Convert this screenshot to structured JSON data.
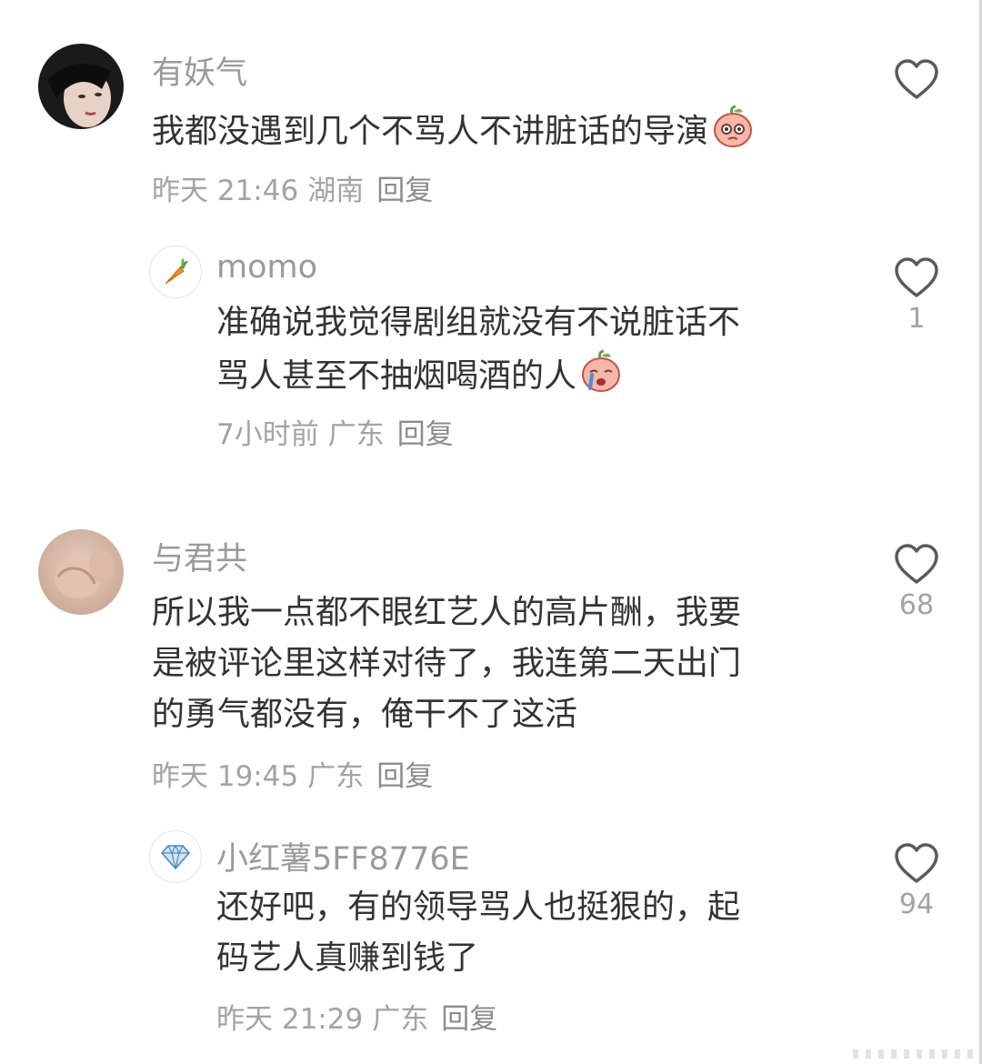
{
  "comments": [
    {
      "username": "有妖气",
      "text_lines": [
        "我都没遇到几个不骂人不讲脏话的导演"
      ],
      "time": "昨天 21:46",
      "location": "湖南",
      "reply_label": "回复",
      "like_count": ""
    },
    {
      "username": "momo",
      "text_lines": [
        "准确说我觉得剧组就没有不说脏话不",
        "骂人甚至不抽烟喝酒的人"
      ],
      "time": "7小时前",
      "location": "广东",
      "reply_label": "回复",
      "like_count": "1"
    },
    {
      "username": "与君共",
      "text_lines": [
        "所以我一点都不眼红艺人的高片酬，我要",
        "是被评论里这样对待了，我连第二天出门",
        "的勇气都没有，俺干不了这活"
      ],
      "time": "昨天 19:45",
      "location": "广东",
      "reply_label": "回复",
      "like_count": "68"
    },
    {
      "username": "小红薯5FF8776E",
      "text_lines": [
        "还好吧，有的领导骂人也挺狠的，起",
        "码艺人真赚到钱了"
      ],
      "time": "昨天 21:29",
      "location": "广东",
      "reply_label": "回复",
      "like_count": "94"
    }
  ],
  "icons": {
    "like": "heart-outline-icon",
    "carrot_avatar": "carrot-icon",
    "diamond_avatar": "diamond-icon",
    "emoji_1": "peach-shy-emoji",
    "emoji_2": "peach-cry-emoji"
  },
  "colors": {
    "text": "#333333",
    "muted": "#a3a3a3",
    "icon": "#5a5a5a"
  }
}
